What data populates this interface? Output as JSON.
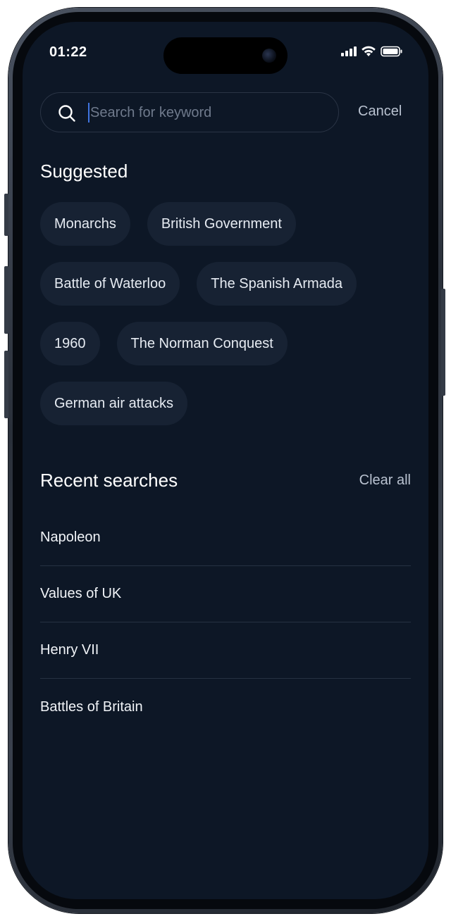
{
  "status_bar": {
    "time": "01:22"
  },
  "search": {
    "placeholder": "Search for keyword",
    "value": "",
    "cancel_label": "Cancel"
  },
  "suggested": {
    "title": "Suggested",
    "chips": [
      [
        "Monarchs",
        "British Government"
      ],
      [
        "Battle of Waterloo",
        "The Spanish Armada"
      ],
      [
        "1960",
        "The Norman Conquest"
      ],
      [
        "German air attacks"
      ]
    ]
  },
  "recent": {
    "title": "Recent searches",
    "clear_label": "Clear all",
    "items": [
      "Napoleon",
      "Values of UK",
      "Henry VII",
      "Battles of Britain"
    ]
  },
  "colors": {
    "background": "#0d1726",
    "chip_background": "#172233",
    "caret": "#3f74e0"
  }
}
